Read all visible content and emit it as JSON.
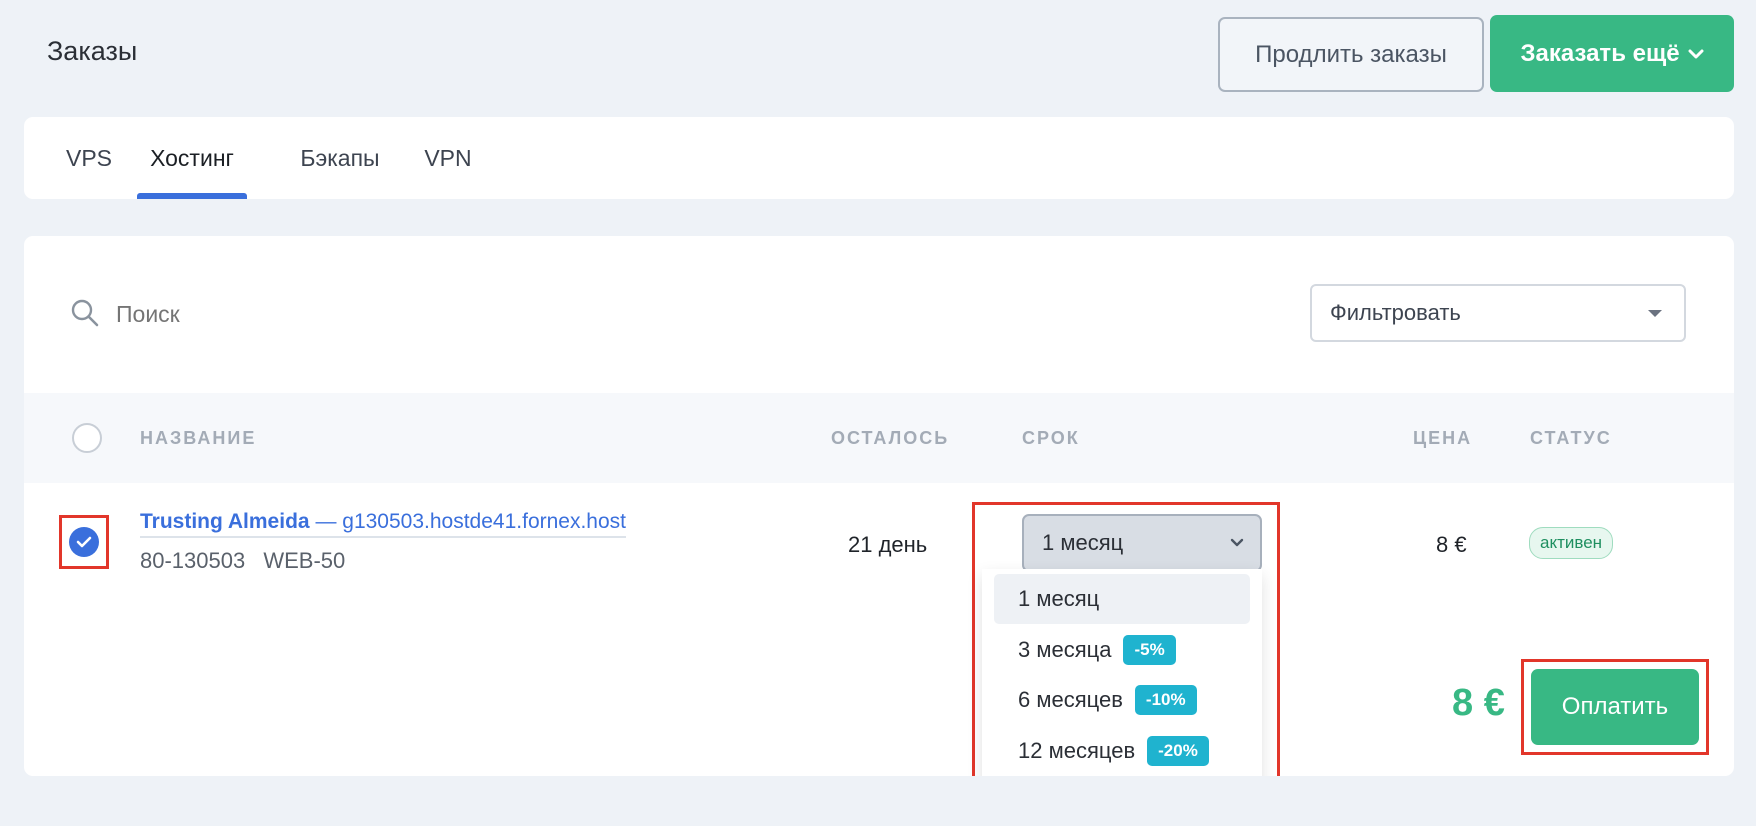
{
  "page": {
    "title": "Заказы",
    "renew_label": "Продлить заказы",
    "order_more_label": "Заказать ещё"
  },
  "tabs": [
    {
      "label": "VPS",
      "active": false
    },
    {
      "label": "Хостинг",
      "active": true
    },
    {
      "label": "Бэкапы",
      "active": false
    },
    {
      "label": "VPN",
      "active": false
    }
  ],
  "search": {
    "placeholder": "Поиск",
    "value": ""
  },
  "filter": {
    "label": "Фильтровать"
  },
  "table": {
    "columns": [
      "НАЗВАНИЕ",
      "ОСТАЛОСЬ",
      "СРОК",
      "ЦЕНА",
      "СТАТУС"
    ],
    "rows": [
      {
        "checked": true,
        "name": "Trusting Almeida",
        "domain": "— g130503.hostde41.fornex.host",
        "order_id": "80-130503",
        "plan": "WEB-50",
        "remaining": "21 день",
        "term": "1 месяц",
        "price": "8 €",
        "status": "активен"
      }
    ]
  },
  "term_options": [
    {
      "label": "1 месяц",
      "discount": "",
      "selected": true
    },
    {
      "label": "3 месяца",
      "discount": "-5%",
      "selected": false
    },
    {
      "label": "6 месяцев",
      "discount": "-10%",
      "selected": false
    },
    {
      "label": "12 месяцев",
      "discount": "-20%",
      "selected": false
    }
  ],
  "footer": {
    "total": "8 €",
    "pay_label": "Оплатить"
  },
  "colors": {
    "accent_green": "#38b884",
    "accent_blue": "#3a6fdc",
    "badge_cyan": "#1fb3cf",
    "highlight_red": "#e2362a"
  },
  "icons": [
    "search-icon",
    "chevron-down-icon",
    "caret-down-icon",
    "check-icon"
  ]
}
